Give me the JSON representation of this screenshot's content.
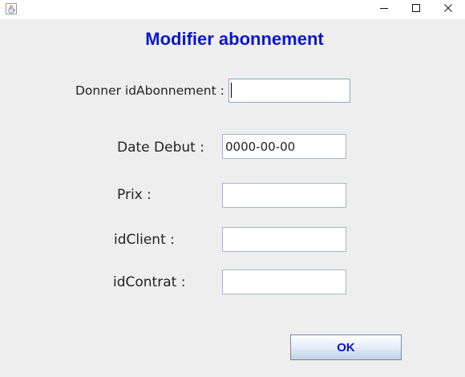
{
  "window": {
    "minimize_glyph": "—",
    "close_glyph": "✕"
  },
  "form": {
    "title": "Modifier abonnement",
    "fields": [
      {
        "label": "Donner idAbonnement :",
        "value": "",
        "placeholder": ""
      },
      {
        "label": "Date Debut :",
        "value": "0000-00-00",
        "placeholder": ""
      },
      {
        "label": "Prix :",
        "value": "",
        "placeholder": ""
      },
      {
        "label": "idClient :",
        "value": "",
        "placeholder": ""
      },
      {
        "label": "idContrat :",
        "value": "",
        "placeholder": ""
      }
    ],
    "ok_label": "OK"
  },
  "colors": {
    "title": "#0a17cc",
    "button_text": "#0a17cc",
    "background": "#eeeeee"
  },
  "icons": {
    "app": "java-cup-icon",
    "minimize": "minimize-icon",
    "maximize": "maximize-icon",
    "close": "close-icon"
  }
}
